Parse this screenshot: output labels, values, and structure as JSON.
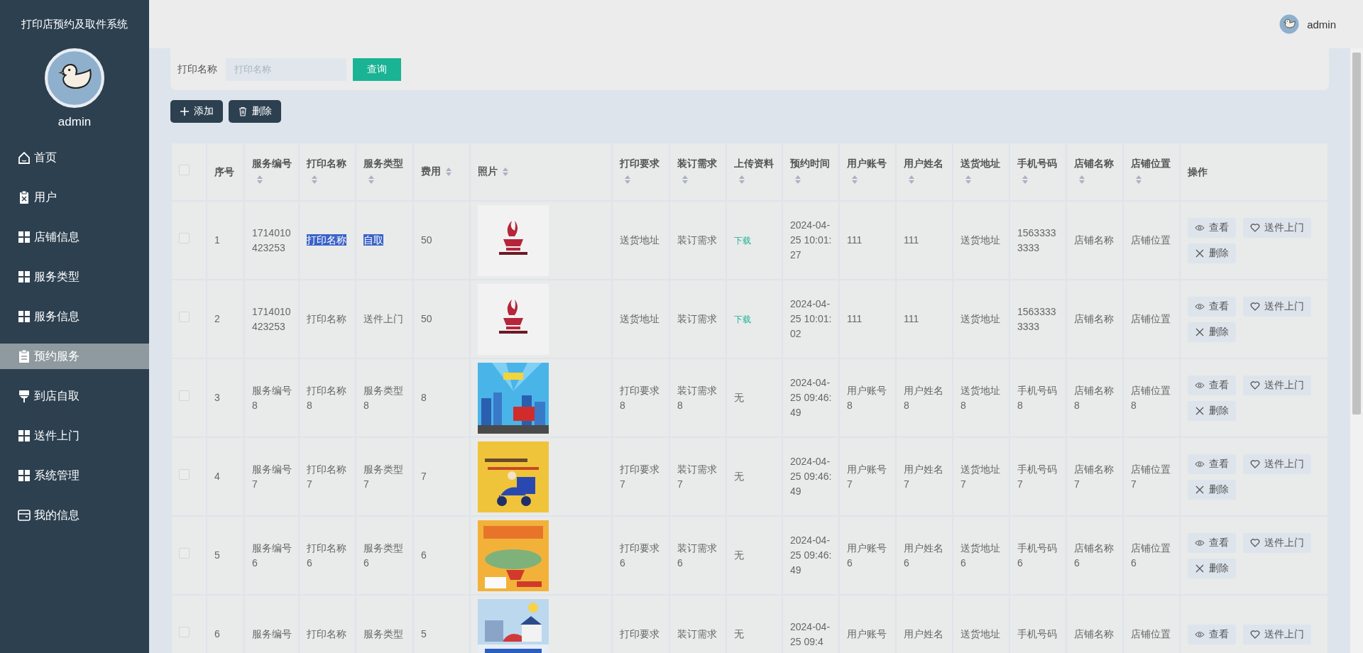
{
  "sidebar": {
    "title": "打印店预约及取件系统",
    "user": "admin",
    "items": [
      {
        "label": "首页",
        "kind": "home",
        "selected": false
      },
      {
        "label": "用户",
        "kind": "clipboardx",
        "selected": false
      },
      {
        "label": "店铺信息",
        "kind": "grid",
        "selected": false
      },
      {
        "label": "服务类型",
        "kind": "grid",
        "selected": false
      },
      {
        "label": "服务信息",
        "kind": "grid",
        "selected": false
      },
      {
        "label": "预约服务",
        "kind": "clipboard",
        "selected": true
      },
      {
        "label": "到店自取",
        "kind": "brush",
        "selected": false
      },
      {
        "label": "送件上门",
        "kind": "grid",
        "selected": false
      },
      {
        "label": "系统管理",
        "kind": "grid",
        "selected": false
      },
      {
        "label": "我的信息",
        "kind": "card",
        "selected": false
      }
    ]
  },
  "topbar": {
    "user": "admin"
  },
  "search": {
    "label": "打印名称",
    "placeholder": "打印名称",
    "button": "查询"
  },
  "toolbar": [
    {
      "label": "添加",
      "kind": "add"
    },
    {
      "label": "删除",
      "kind": "delete"
    }
  ],
  "table": {
    "select_all_checked": false,
    "columns": [
      {
        "label": "序号",
        "sortable": false
      },
      {
        "label": "服务编号",
        "sortable": true
      },
      {
        "label": "打印名称",
        "sortable": true
      },
      {
        "label": "服务类型",
        "sortable": true
      },
      {
        "label": "费用",
        "sortable": true
      },
      {
        "label": "照片",
        "sortable": true
      },
      {
        "label": "打印要求",
        "sortable": true
      },
      {
        "label": "装订需求",
        "sortable": true
      },
      {
        "label": "上传资料",
        "sortable": true
      },
      {
        "label": "预约时间",
        "sortable": true
      },
      {
        "label": "用户账号",
        "sortable": true
      },
      {
        "label": "用户姓名",
        "sortable": true
      },
      {
        "label": "送货地址",
        "sortable": true
      },
      {
        "label": "手机号码",
        "sortable": true
      },
      {
        "label": "店铺名称",
        "sortable": true
      },
      {
        "label": "店铺位置",
        "sortable": true
      },
      {
        "label": "操作",
        "sortable": false
      }
    ],
    "rows": [
      {
        "checked": false,
        "cells": [
          "1",
          "1714010423253",
          {
            "text": "打印名称",
            "highlighted": true
          },
          {
            "text": "自取",
            "highlighted": true
          },
          "50",
          {
            "kind": "picture"
          },
          "送货地址",
          "装订需求",
          {
            "text": "下载",
            "kind": "link"
          },
          "2024-04-25 10:01:27",
          "111",
          "111",
          "送货地址",
          "15633333333",
          "店铺名称",
          "店铺位置"
        ],
        "actions": [
          {
            "label": "查看",
            "kind": "view"
          },
          {
            "label": "送件上门",
            "kind": "deliver"
          },
          {
            "label": "删除",
            "kind": "delete"
          }
        ]
      },
      {
        "checked": false,
        "cells": [
          "2",
          "1714010423253",
          "打印名称",
          "送件上门",
          "50",
          {
            "kind": "picture"
          },
          "送货地址",
          "装订需求",
          {
            "text": "下载",
            "kind": "link"
          },
          "2024-04-25 10:01:02",
          "111",
          "111",
          "送货地址",
          "15633333333",
          "店铺名称",
          "店铺位置"
        ],
        "actions": [
          {
            "label": "查看",
            "kind": "view"
          },
          {
            "label": "送件上门",
            "kind": "deliver"
          },
          {
            "label": "删除",
            "kind": "delete"
          }
        ]
      },
      {
        "checked": false,
        "cells": [
          "3",
          "服务编号8",
          "打印名称8",
          "服务类型8",
          "8",
          {
            "kind": "picture"
          },
          "打印要求8",
          "装订需求8",
          "无",
          "2024-04-25 09:46:49",
          "用户账号8",
          "用户姓名8",
          "送货地址8",
          "手机号码8",
          "店铺名称8",
          "店铺位置8"
        ],
        "actions": [
          {
            "label": "查看",
            "kind": "view"
          },
          {
            "label": "送件上门",
            "kind": "deliver"
          },
          {
            "label": "删除",
            "kind": "delete"
          }
        ]
      },
      {
        "checked": false,
        "cells": [
          "4",
          "服务编号7",
          "打印名称7",
          "服务类型7",
          "7",
          {
            "kind": "picture"
          },
          "打印要求7",
          "装订需求7",
          "无",
          "2024-04-25 09:46:49",
          "用户账号7",
          "用户姓名7",
          "送货地址7",
          "手机号码7",
          "店铺名称7",
          "店铺位置7"
        ],
        "actions": [
          {
            "label": "查看",
            "kind": "view"
          },
          {
            "label": "送件上门",
            "kind": "deliver"
          },
          {
            "label": "删除",
            "kind": "delete"
          }
        ]
      },
      {
        "checked": false,
        "cells": [
          "5",
          "服务编号6",
          "打印名称6",
          "服务类型6",
          "6",
          {
            "kind": "picture"
          },
          "打印要求6",
          "装订需求6",
          "无",
          "2024-04-25 09:46:49",
          "用户账号6",
          "用户姓名6",
          "送货地址6",
          "手机号码6",
          "店铺名称6",
          "店铺位置6"
        ],
        "actions": [
          {
            "label": "查看",
            "kind": "view"
          },
          {
            "label": "送件上门",
            "kind": "deliver"
          },
          {
            "label": "删除",
            "kind": "delete"
          }
        ]
      },
      {
        "checked": false,
        "cells": [
          "6",
          "服务编号",
          "打印名称",
          "服务类型",
          "5",
          {
            "kind": "picture"
          },
          "打印要求",
          "装订需求",
          "无",
          "2024-04-25 09:4",
          "用户账号",
          "用户姓名",
          "送货地址",
          "手机号码",
          "店铺名称",
          "店铺位置"
        ],
        "actions": [
          {
            "label": "查看",
            "kind": "view"
          },
          {
            "label": "送件上门",
            "kind": "deliver"
          }
        ]
      }
    ]
  }
}
